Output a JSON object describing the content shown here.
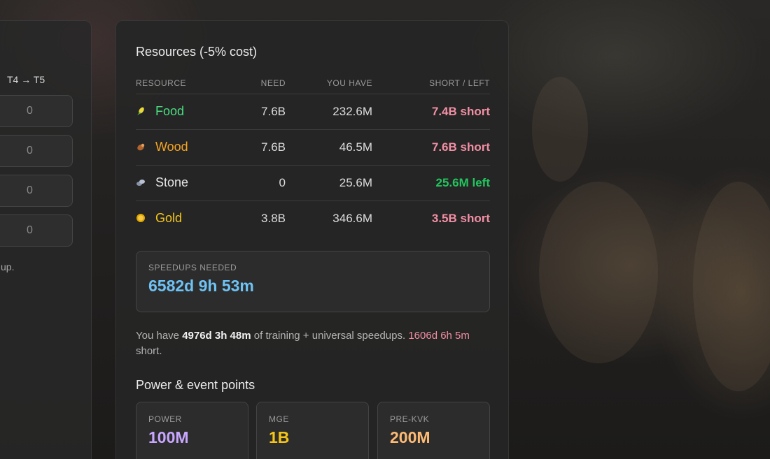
{
  "left_panel": {
    "column_header": "T4 → T5",
    "inputs": [
      "0",
      "0",
      "0",
      "0"
    ],
    "note": "up."
  },
  "resources": {
    "title": "Resources (-5% cost)",
    "columns": [
      "RESOURCE",
      "NEED",
      "YOU HAVE",
      "SHORT / LEFT"
    ],
    "rows": [
      {
        "name": "Food",
        "need": "7.6B",
        "have": "232.6M",
        "status": "7.4B short",
        "name_color": "#4ade80",
        "status_color": "#f28fa4",
        "icon": "corn-icon"
      },
      {
        "name": "Wood",
        "need": "7.6B",
        "have": "46.5M",
        "status": "7.6B short",
        "name_color": "#f5a524",
        "status_color": "#f28fa4",
        "icon": "log-icon"
      },
      {
        "name": "Stone",
        "need": "0",
        "have": "25.6M",
        "status": "25.6M left",
        "name_color": "#e6e6e6",
        "status_color": "#22c55e",
        "icon": "stone-icon"
      },
      {
        "name": "Gold",
        "need": "3.8B",
        "have": "346.6M",
        "status": "3.5B short",
        "name_color": "#f5c518",
        "status_color": "#f28fa4",
        "icon": "gold-coin-icon"
      }
    ]
  },
  "speedups": {
    "label": "SPEEDUPS NEEDED",
    "value": "6582d 9h 53m",
    "value_color": "#6ec3f4"
  },
  "summary": {
    "prefix": "You have ",
    "have": "4976d 3h 48m",
    "middle": " of training + universal speedups. ",
    "short": "1606d 6h 5m",
    "suffix": " short."
  },
  "power": {
    "title": "Power & event points",
    "stats": [
      {
        "label": "POWER",
        "value": "100M",
        "color": "#c7a6ff"
      },
      {
        "label": "MGE",
        "value": "1B",
        "color": "#f5c518"
      },
      {
        "label": "PRE-KVK",
        "value": "200M",
        "color": "#fdba74"
      }
    ]
  }
}
